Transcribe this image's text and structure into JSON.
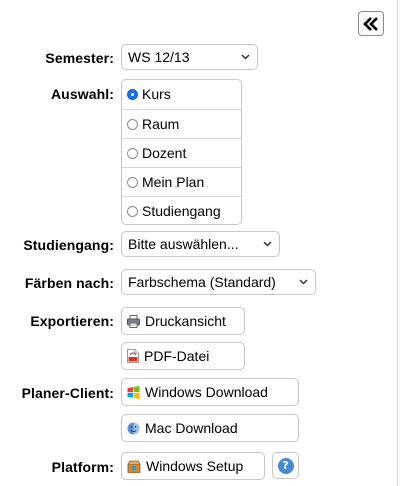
{
  "panel": {
    "collapse_icon": "double-chevron-left-icon",
    "semester": {
      "label": "Semester:",
      "value": "WS 12/13"
    },
    "auswahl": {
      "label": "Auswahl:",
      "options": [
        {
          "label": "Kurs",
          "checked": true
        },
        {
          "label": "Raum",
          "checked": false
        },
        {
          "label": "Dozent",
          "checked": false
        },
        {
          "label": "Mein Plan",
          "checked": false
        },
        {
          "label": "Studiengang",
          "checked": false
        }
      ]
    },
    "studiengang": {
      "label": "Studiengang:",
      "value": "Bitte auswählen..."
    },
    "faerben": {
      "label": "Färben nach:",
      "value": "Farbschema (Standard)"
    },
    "exportieren": {
      "label": "Exportieren:",
      "print_label": "Druckansicht",
      "pdf_label": "PDF-Datei"
    },
    "planer_client": {
      "label": "Planer-Client:",
      "windows_label": "Windows Download",
      "mac_label": "Mac Download"
    },
    "platform": {
      "label": "Platform:",
      "setup_label": "Windows Setup",
      "help_text": "?"
    },
    "colors": {
      "accent": "#1a6ff0",
      "help": "#4a8bd6",
      "border": "#c7c7c7"
    }
  }
}
